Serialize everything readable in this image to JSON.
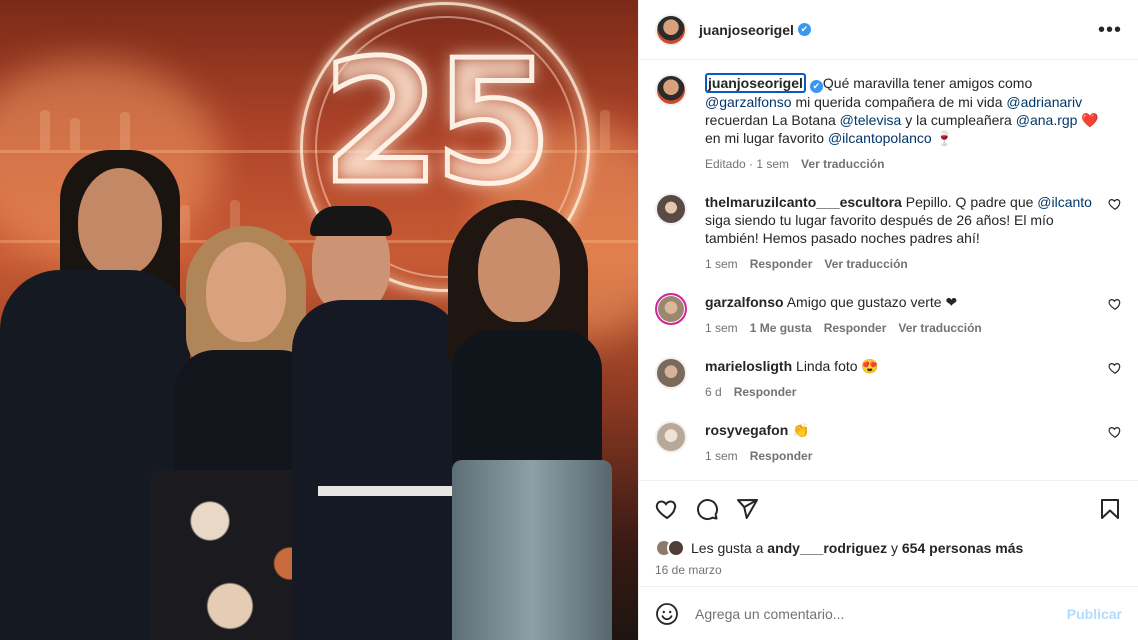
{
  "post": {
    "author": "juanjoseorigel",
    "verified_glyph": "✔",
    "more_label": "•••",
    "caption": {
      "segments": [
        {
          "t": "Qué maravilla tener amigos como ",
          "m": false
        },
        {
          "t": "@garzalfonso",
          "m": true
        },
        {
          "t": " mi querida compañera de mi vida ",
          "m": false
        },
        {
          "t": "@adrianariv",
          "m": true
        },
        {
          "t": " recuerdan La Botana ",
          "m": false
        },
        {
          "t": "@televisa",
          "m": true
        },
        {
          "t": " y la cumpleañera ",
          "m": false
        },
        {
          "t": "@ana.rgp",
          "m": true
        },
        {
          "t": " ❤️ en mi lugar favorito ",
          "m": false
        },
        {
          "t": "@ilcantopolanco",
          "m": true
        },
        {
          "t": " 🍷",
          "m": false
        }
      ],
      "meta_edited": "Editado · 1 sem",
      "meta_translate": "Ver traducción"
    },
    "photo": {
      "neon_text": "25"
    }
  },
  "comments": [
    {
      "user": "thelmaruzilcanto___escultora",
      "segments": [
        {
          "t": "Pepillo. Q padre que ",
          "m": false
        },
        {
          "t": "@ilcanto",
          "m": true
        },
        {
          "t": " siga siendo tu lugar favorito después de 26 años! El mío también! Hemos pasado noches padres ahí!",
          "m": false
        }
      ],
      "time": "1 sem",
      "likes": "",
      "reply": "Responder",
      "translate": "Ver traducción",
      "avatar": "#5a4a44"
    },
    {
      "user": "garzalfonso",
      "segments": [
        {
          "t": "Amigo que gustazo verte ❤",
          "m": false
        }
      ],
      "time": "1 sem",
      "likes": "1 Me gusta",
      "reply": "Responder",
      "translate": "Ver traducción",
      "avatar": "#c9a98a",
      "story_ring": true
    },
    {
      "user": "marielosligth",
      "segments": [
        {
          "t": "Linda foto 😍",
          "m": false
        }
      ],
      "time": "6 d",
      "likes": "",
      "reply": "Responder",
      "translate": "",
      "avatar": "#7a6a5c"
    },
    {
      "user": "rosyvegafon",
      "segments": [
        {
          "t": "👏",
          "m": false
        }
      ],
      "time": "1 sem",
      "likes": "",
      "reply": "Responder",
      "translate": "",
      "avatar": "#b8a89a"
    }
  ],
  "likes_summary": {
    "prefix": "Les gusta a ",
    "user": "andy___rodriguez",
    "mid": " y ",
    "count": "654 personas más"
  },
  "date": "16 de marzo",
  "add_comment": {
    "placeholder": "Agrega un comentario...",
    "publish": "Publicar"
  },
  "colors": {
    "mention": "#00376b",
    "muted": "#737373",
    "verified": "#3897f0",
    "publish_disabled": "#b3dbff"
  }
}
